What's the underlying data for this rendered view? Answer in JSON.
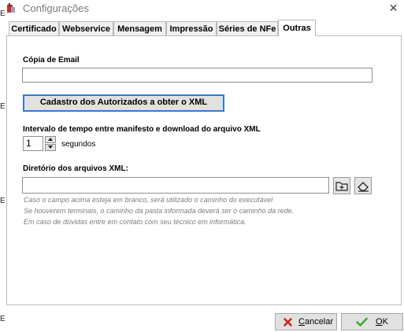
{
  "window": {
    "title": "Configurações"
  },
  "tabs": [
    {
      "label": "Certificado",
      "active": false
    },
    {
      "label": "Webservice",
      "active": false
    },
    {
      "label": "Mensagem",
      "active": false
    },
    {
      "label": "Impressão",
      "active": false
    },
    {
      "label": "Séries de NFe",
      "active": false
    },
    {
      "label": "Outras",
      "active": true
    }
  ],
  "form": {
    "email_copy_label": "Cópia de  Email",
    "email_copy_value": "",
    "authorized_button": "Cadastro dos Autorizados a obter o XML",
    "interval_label": "Intervalo de tempo entre manifesto e download do arquivo XML",
    "interval_value": "1",
    "interval_unit": "segundos",
    "directory_label": "Diretório dos arquivos XML:",
    "directory_value": "",
    "hints": [
      "Caso o campo acima esteja em branco, será utilizado o caminho do executável",
      "Se houverem terminais, o caminho da pasta informada deverá ser o caminho da rede.",
      "Em caso de dúvidas entre em contato com seu técnico em informática."
    ]
  },
  "buttons": {
    "cancel_first": "C",
    "cancel_rest": "ancelar",
    "ok_first": "O",
    "ok_rest": "K"
  },
  "colors": {
    "focus_border": "#2f7bd6",
    "cancel_icon": "#d21d1d",
    "ok_icon": "#3ca93c"
  },
  "edge_glyphs": [
    "E",
    "E",
    "E",
    "E"
  ]
}
